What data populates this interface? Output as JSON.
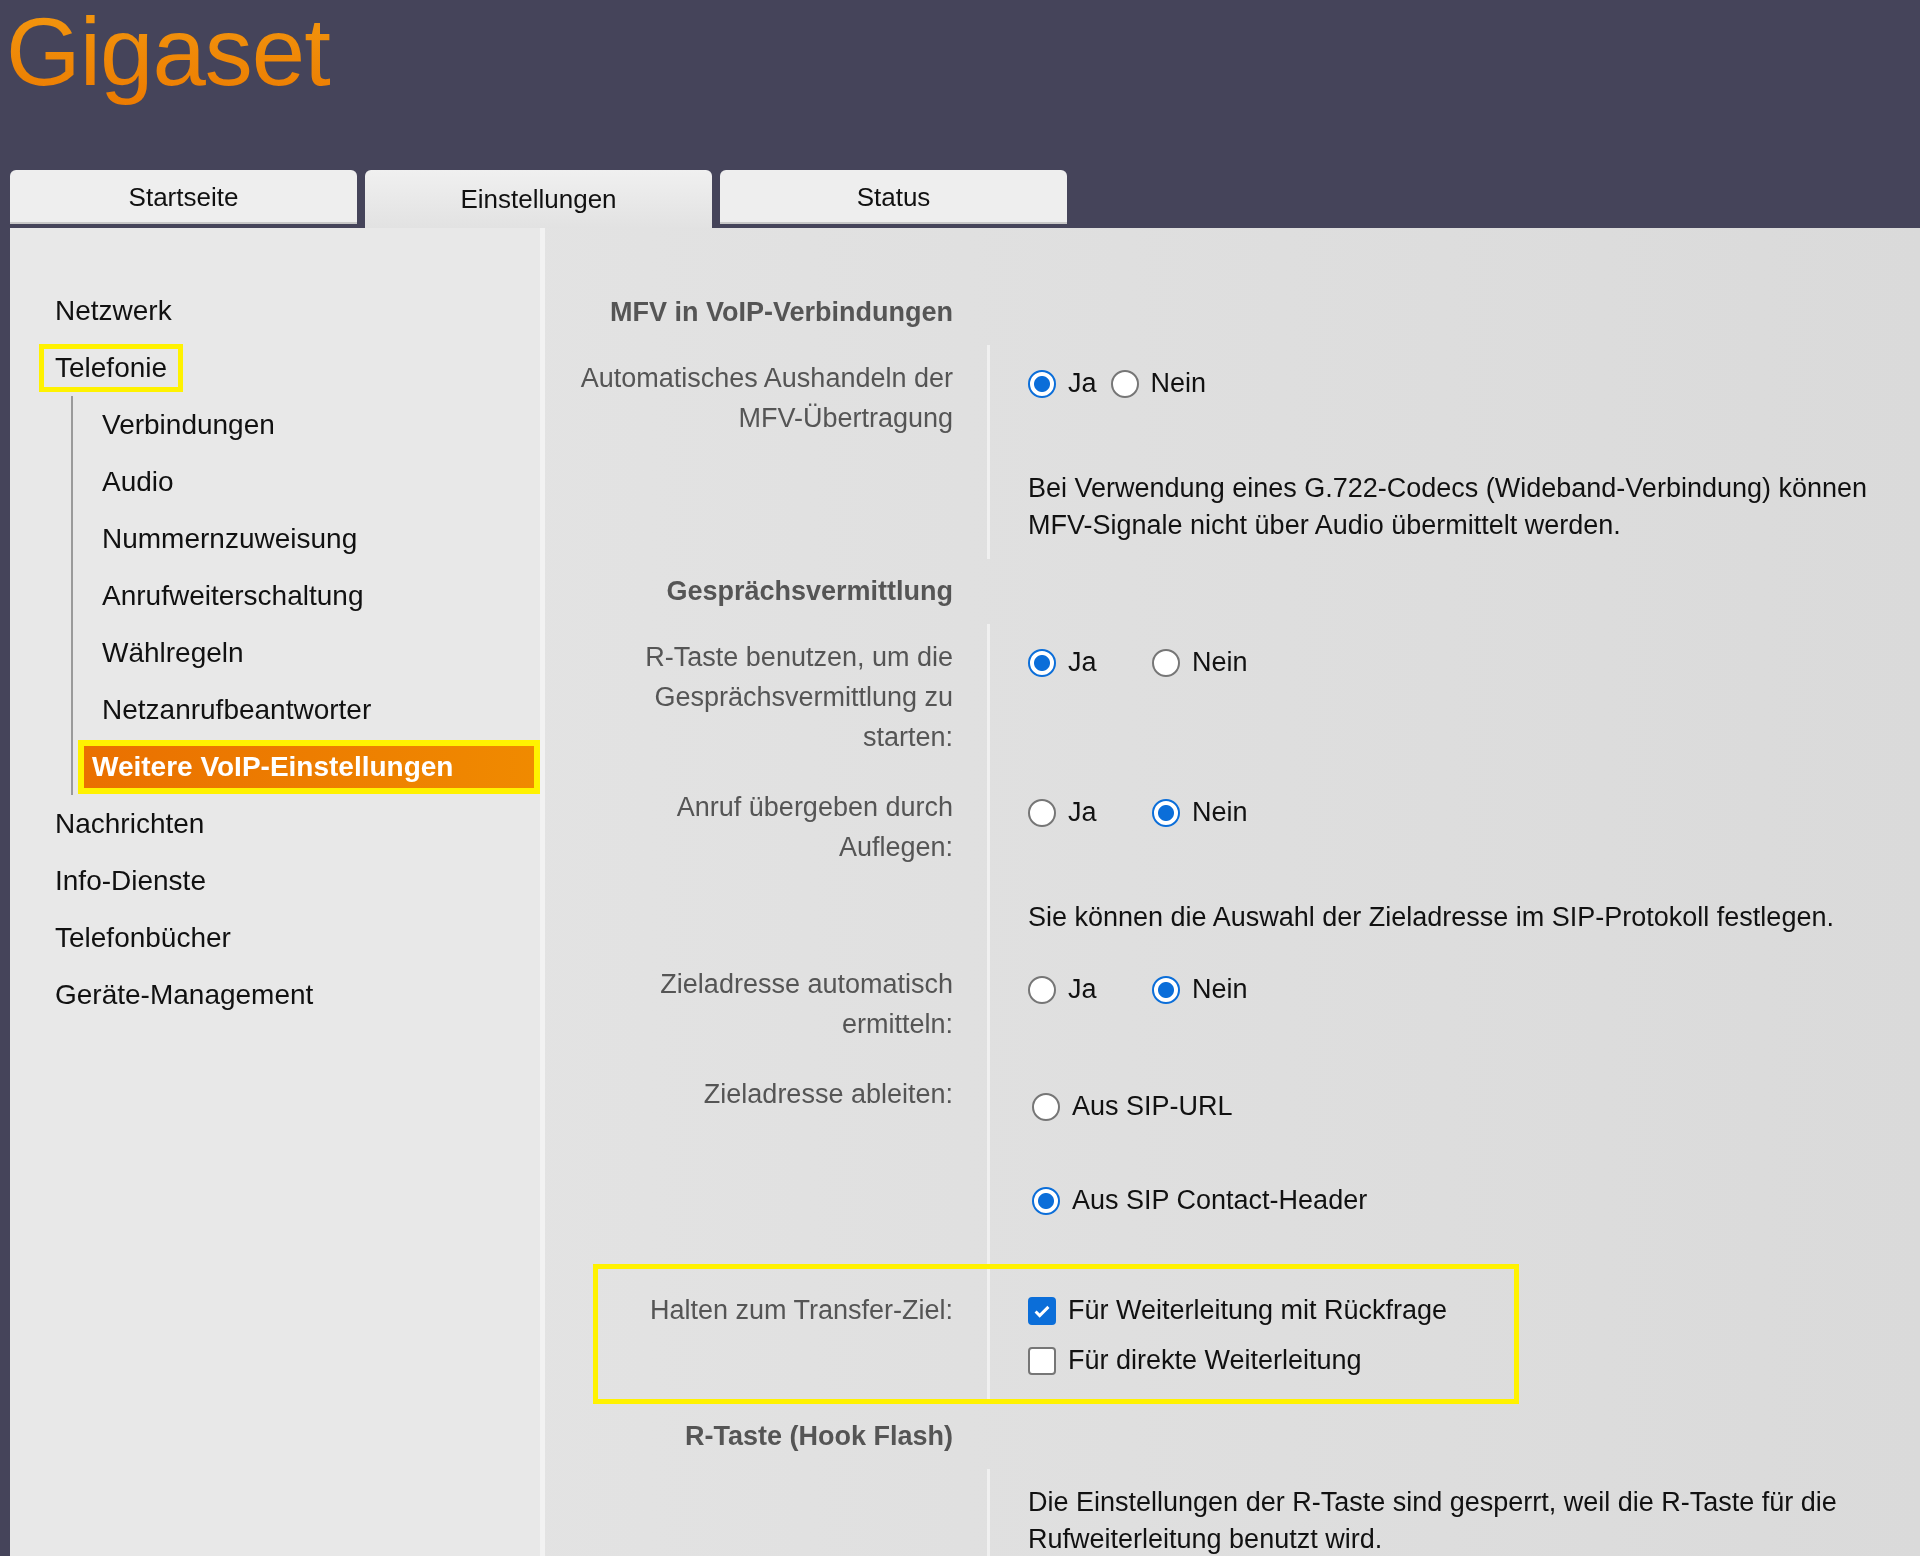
{
  "logo": "Gigaset",
  "tabs": [
    {
      "label": "Startseite",
      "selected": false
    },
    {
      "label": "Einstellungen",
      "selected": true
    },
    {
      "label": "Status",
      "selected": false
    }
  ],
  "sidebar": {
    "items": [
      {
        "label": "Netzwerk",
        "selected": false,
        "highlighted": false
      },
      {
        "label": "Telefonie",
        "selected": false,
        "highlighted": true,
        "children": [
          {
            "label": "Verbindungen",
            "selected": false,
            "highlighted": false
          },
          {
            "label": "Audio",
            "selected": false,
            "highlighted": false
          },
          {
            "label": "Nummernzuweisung",
            "selected": false,
            "highlighted": false
          },
          {
            "label": "Anrufweiterschaltung",
            "selected": false,
            "highlighted": false
          },
          {
            "label": "Wählregeln",
            "selected": false,
            "highlighted": false
          },
          {
            "label": "Netzanrufbeantworter",
            "selected": false,
            "highlighted": false
          },
          {
            "label": "Weitere VoIP-Einstellungen",
            "selected": true,
            "highlighted": true
          }
        ]
      },
      {
        "label": "Nachrichten",
        "selected": false,
        "highlighted": false
      },
      {
        "label": "Info-Dienste",
        "selected": false,
        "highlighted": false
      },
      {
        "label": "Telefonbücher",
        "selected": false,
        "highlighted": false
      },
      {
        "label": "Geräte-Management",
        "selected": false,
        "highlighted": false
      }
    ]
  },
  "form": {
    "rows": [
      {
        "kind": "heading",
        "text": "MFV in VoIP-Verbindungen"
      },
      {
        "kind": "radio-compact",
        "label": "Automatisches Aushandeln der MFV-Übertragung",
        "highlighted": false,
        "options": [
          {
            "label": "Ja",
            "selected": true
          },
          {
            "label": "Nein",
            "selected": false
          }
        ]
      },
      {
        "kind": "note",
        "text": "Bei Verwendung eines G.722-Codecs (Wideband-Verbindung) können MFV-Signale nicht über Audio übermittelt werden."
      },
      {
        "kind": "heading",
        "text": "Gesprächsvermittlung"
      },
      {
        "kind": "radio",
        "label": "R-Taste benutzen, um die Gesprächsvermittlung zu starten:",
        "highlighted": false,
        "options": [
          {
            "label": "Ja",
            "selected": true
          },
          {
            "label": "Nein",
            "selected": false
          }
        ]
      },
      {
        "kind": "radio",
        "label": "Anruf übergeben durch Auflegen:",
        "highlighted": false,
        "options": [
          {
            "label": "Ja",
            "selected": false
          },
          {
            "label": "Nein",
            "selected": true
          }
        ]
      },
      {
        "kind": "note",
        "text": "Sie können die Auswahl der Zieladresse im SIP-Protokoll festlegen."
      },
      {
        "kind": "radio",
        "label": "Zieladresse automatisch ermitteln:",
        "highlighted": false,
        "options": [
          {
            "label": "Ja",
            "selected": false
          },
          {
            "label": "Nein",
            "selected": true
          }
        ]
      },
      {
        "kind": "radio-stack",
        "label": "Zieladresse ableiten:",
        "highlighted": false,
        "options": [
          {
            "label": "Aus SIP-URL",
            "selected": false
          },
          {
            "label": "Aus SIP Contact-Header",
            "selected": true
          }
        ]
      },
      {
        "kind": "checkbox",
        "label": "Halten zum Transfer-Ziel:",
        "highlighted": true,
        "options": [
          {
            "label": "Für Weiterleitung mit Rückfrage",
            "checked": true
          },
          {
            "label": "Für direkte Weiterleitung",
            "checked": false
          }
        ]
      },
      {
        "kind": "heading",
        "text": "R-Taste (Hook Flash)"
      },
      {
        "kind": "note",
        "text": "Die Einstellungen der R-Taste sind gesperrt, weil die R-Taste für die Rufweiterleitung benutzt wird."
      }
    ]
  }
}
